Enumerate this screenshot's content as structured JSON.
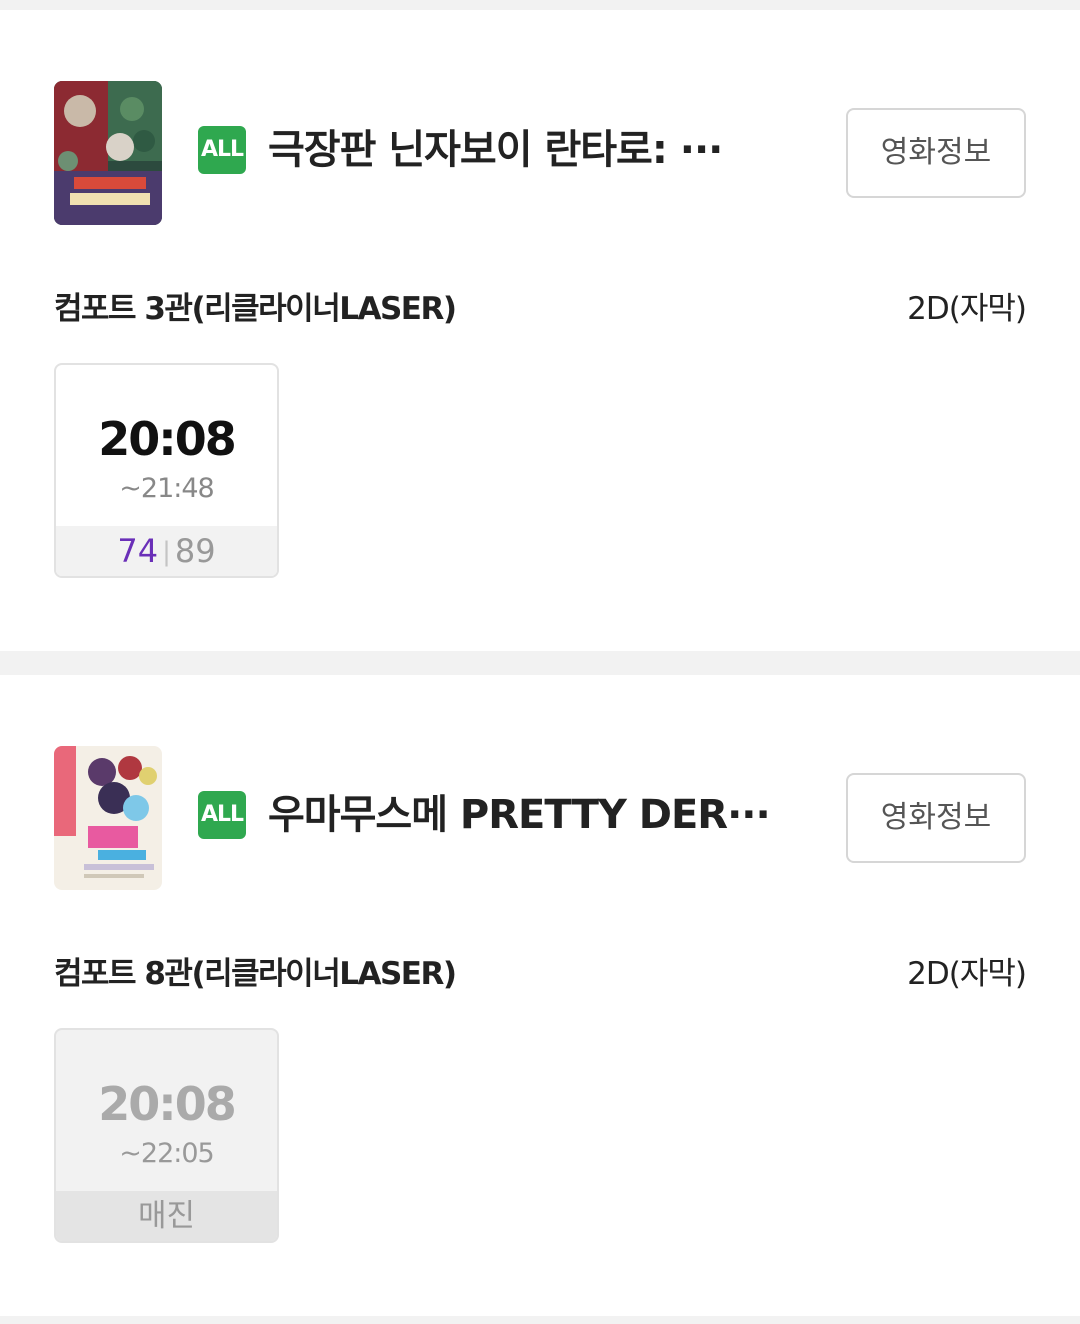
{
  "movies": [
    {
      "rating": "ALL",
      "title": "극장판 닌자보이 란타로: ",
      "title_ellipsis": "···",
      "info_button": "영화정보",
      "screen": "컴포트 3관(리클라이너LASER)",
      "format": "2D(자막)",
      "showtimes": [
        {
          "start": "20:08",
          "end": "~21:48",
          "seats_available": "74",
          "seats_separator": "|",
          "seats_total": "89"
        }
      ]
    },
    {
      "rating": "ALL",
      "title": "우마무스메 PRETTY DER",
      "title_ellipsis": "···",
      "info_button": "영화정보",
      "screen": "컴포트 8관(리클라이너LASER)",
      "format": "2D(자막)",
      "showtimes": [
        {
          "start": "20:08",
          "end": "~22:05",
          "status": "매진"
        }
      ]
    }
  ],
  "colors": {
    "rating_badge": "#2fa84f",
    "seats_available": "#6a2fb8",
    "divider_background": "#f2f2f2"
  }
}
